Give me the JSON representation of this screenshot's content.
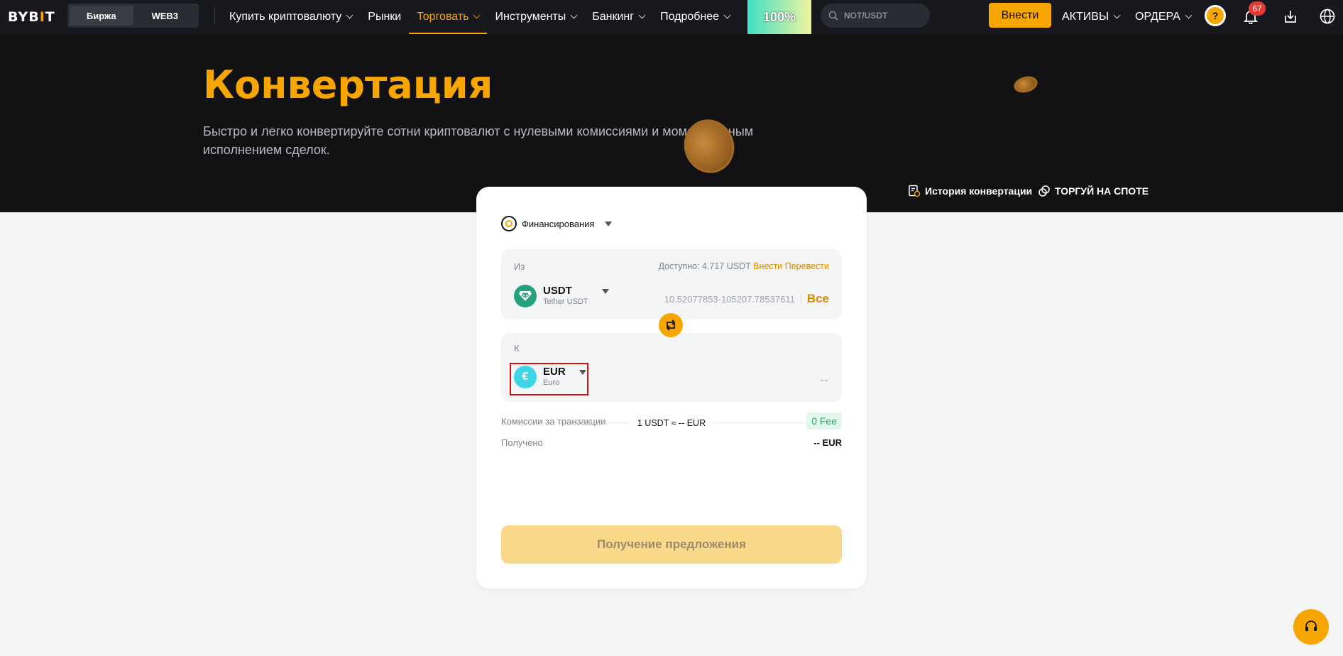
{
  "nav": {
    "logo_left": "BYB",
    "logo_bar": "I",
    "logo_right": "T",
    "seg_exchange": "Биржа",
    "seg_web3": "WEB3",
    "items": [
      {
        "label": "Купить криптовалюту"
      },
      {
        "label": "Рынки"
      },
      {
        "label": "Торговать"
      },
      {
        "label": "Инструменты"
      },
      {
        "label": "Банкинг"
      },
      {
        "label": "Подробнее"
      }
    ],
    "promo_text": "100%",
    "search_placeholder": "NOT/USDT",
    "deposit_label": "Внести",
    "assets_label": "АКТИВЫ",
    "orders_label": "ОРДЕРА",
    "avatar_char": "?",
    "notifications_count": "67"
  },
  "hero": {
    "title": "Конвертация",
    "subtitle": "Быстро и легко конвертируйте сотни криптовалют с нулевыми комиссиями и моментальным исполнением сделок.",
    "history_label": "История конвертации",
    "spot_label": "ТОРГУЙ НА СПОТЕ"
  },
  "card": {
    "account": "Финансирования",
    "from": {
      "label": "Из",
      "available_prefix": "Доступно: 4.717 USDT",
      "deposit_link": "Внести",
      "transfer_link": "Перевести",
      "currency": "USDT",
      "currency_name": "Tether USDT",
      "range": "10.52077853-105207.78537611",
      "all_label": "Все"
    },
    "to": {
      "label": "К",
      "currency": "EUR",
      "currency_name": "Euro",
      "amount": "--"
    },
    "rate": "1 USDT ≈ -- EUR",
    "fee_label": "Комиссии за транзакции",
    "fee_value": "0 Fee",
    "received_label": "Получено",
    "received_value": "-- EUR",
    "quote_button": "Получение предложения"
  },
  "colors": {
    "accent": "#f7a600",
    "highlight_box": "#d80d0d"
  }
}
